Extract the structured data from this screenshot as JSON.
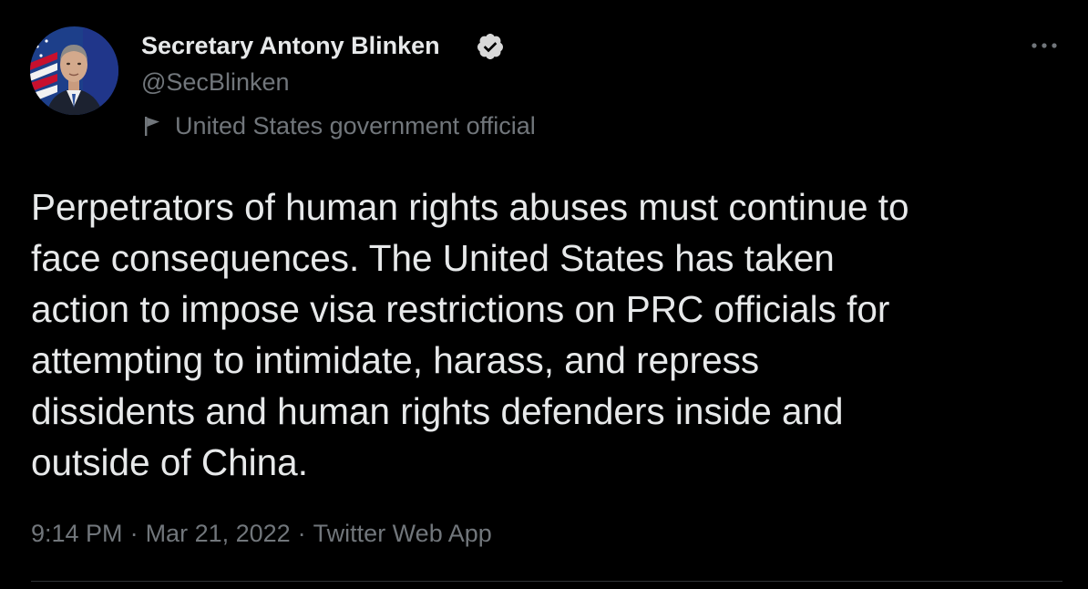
{
  "author": {
    "display_name": "Secretary Antony Blinken",
    "handle": "@SecBlinken",
    "label": "United States government official",
    "verified_color": "#d9d9d9"
  },
  "icons": {
    "more": "more-horizontal-icon",
    "verified": "verified-badge-icon",
    "label": "flag-icon"
  },
  "tweet": {
    "text": "Perpetrators of human rights abuses must continue to\nface consequences. The United States has taken\naction to impose visa restrictions on PRC officials for\nattempting to intimidate, harass, and repress\ndissidents and human rights defenders inside and\noutside of China."
  },
  "meta": {
    "time": "9:14 PM",
    "separator": "·",
    "date": "Mar 21, 2022",
    "source": "Twitter Web App"
  },
  "colors": {
    "background": "#000000",
    "primary_text": "#e7e9ea",
    "secondary_text": "#71767b",
    "divider": "#2f3336"
  }
}
